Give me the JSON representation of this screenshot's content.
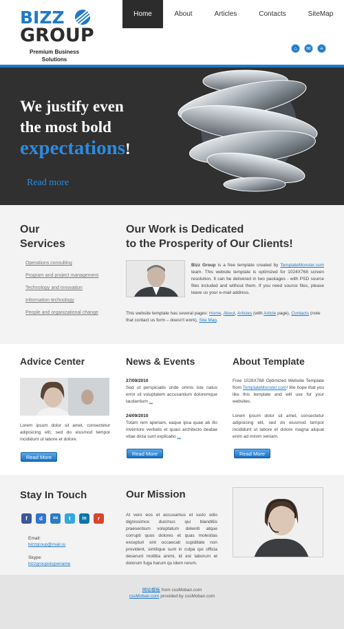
{
  "brand": {
    "line1": "BIZZ",
    "line2": "GROUP",
    "tagline": "Premium Business Solutions",
    "accent_color": "#1e7ac8",
    "dark_color": "#2c2c2c"
  },
  "nav": [
    {
      "label": "Home",
      "active": true
    },
    {
      "label": "About",
      "active": false
    },
    {
      "label": "Articles",
      "active": false
    },
    {
      "label": "Contacts",
      "active": false
    },
    {
      "label": "SiteMap",
      "active": false
    }
  ],
  "header_icons": [
    "home-icon",
    "mail-icon",
    "sitemap-icon"
  ],
  "hero": {
    "line1": "We justify even",
    "line2": "the most bold",
    "accent": "expectations",
    "exclaim": "!",
    "read_more": "Read more"
  },
  "services": {
    "title1": "Our",
    "title2": "Services",
    "items": [
      "Operations consulting",
      "Program and project management",
      "Technology and innovation",
      "Information technology",
      "People and organizational change"
    ]
  },
  "work": {
    "title1": "Our Work is Dedicated",
    "title2": "to the Prosperity of Our Clients!",
    "p1_bold": "Bizz Group",
    "p1_a": " is a free template created by ",
    "p1_link": "TemplateMonster.com",
    "p1_b": " team. This website template is optimized for 1024X768 screen resolution. It can be delivered in two packages - with PSD source files included and without them. If you need source files, please leave us your e-mail address.",
    "p2_a": "This website template has several pages: ",
    "p2_home": "Home",
    "p2_sep1": ", ",
    "p2_about": "About",
    "p2_sep2": ", ",
    "p2_articles": "Articles",
    "p2_b": " (with ",
    "p2_article": "Article",
    "p2_c": " page), ",
    "p2_contacts": "Contacts",
    "p2_d": " (note that contact us form – doesn't work), ",
    "p2_sitemap": "Site Map",
    "p2_e": "."
  },
  "advice": {
    "title": "Advice Center",
    "text": "Lorem ipsum dolor sit amet, consectetur adipisicing elit, sed do eiusmod tempor incididunt ut labore et dolore.",
    "button": "Read More"
  },
  "news": {
    "title": "News & Events",
    "items": [
      {
        "date": "27/09/2010",
        "text": "Sed ut perspiciatis unde omnis iste natus error sit voluptatem accusantium doloremque laudantium",
        "more": "..."
      },
      {
        "date": "24/09/2010",
        "text": "Totam rem aperiam, eaque ipsa quae ab illo inventore veritatis et quasi architecto beatae vitae dicta sunt explicabo",
        "more": "..."
      }
    ],
    "button": "Read More"
  },
  "about": {
    "title": "About Template",
    "p1_a": "Free 1028X768 Optimized Website Template from ",
    "p1_link": "TemplateMonster.com",
    "p1_b": "! We hope that you like this template and will use for your websites.",
    "p2": "Lorem ipsum dolor sit amet, consectetur adipisicing elit, sed do eiusmod tempor incididunt ut labore et dolore magna aliquat enim ad minim veniam.",
    "button": "Read More"
  },
  "touch": {
    "title": "Stay In Touch",
    "social": [
      {
        "icon": "facebook-icon",
        "glyph": "f",
        "color": "#3b5998"
      },
      {
        "icon": "delicious-icon",
        "glyph": "d",
        "color": "#3274d0"
      },
      {
        "icon": "stumbleupon-icon",
        "glyph": "su",
        "color": "#2b7bc4"
      },
      {
        "icon": "twitter-icon",
        "glyph": "t",
        "color": "#33a8dc"
      },
      {
        "icon": "linkedin-icon",
        "glyph": "in",
        "color": "#0e76a8"
      },
      {
        "icon": "rss-icon",
        "glyph": "r",
        "color": "#d9442c"
      }
    ],
    "email_label": "Email:",
    "email": "bizzgroup@mail.ru",
    "skype_label": "Skype:",
    "skype": "bizzgroupskypename"
  },
  "mission": {
    "title": "Our Mission",
    "text": "At vero eos et accusamus et iusto odio dignissimos ducimus qui blanditiis praesentium voluptatum deleniti atque corrupti quos dolores et quas molestias excepturi sint occaecati cupiditate non provident, similique sunt in culpa qui officia deserunt mollitia animi, id est laborum et dolorum fuga harum qu idem rerum."
  },
  "footer": {
    "link1": "网站模板",
    "from1": " from cssMoban.com",
    "link2": "cssMoban.com",
    "from2": " provided by cssMoban.com"
  }
}
